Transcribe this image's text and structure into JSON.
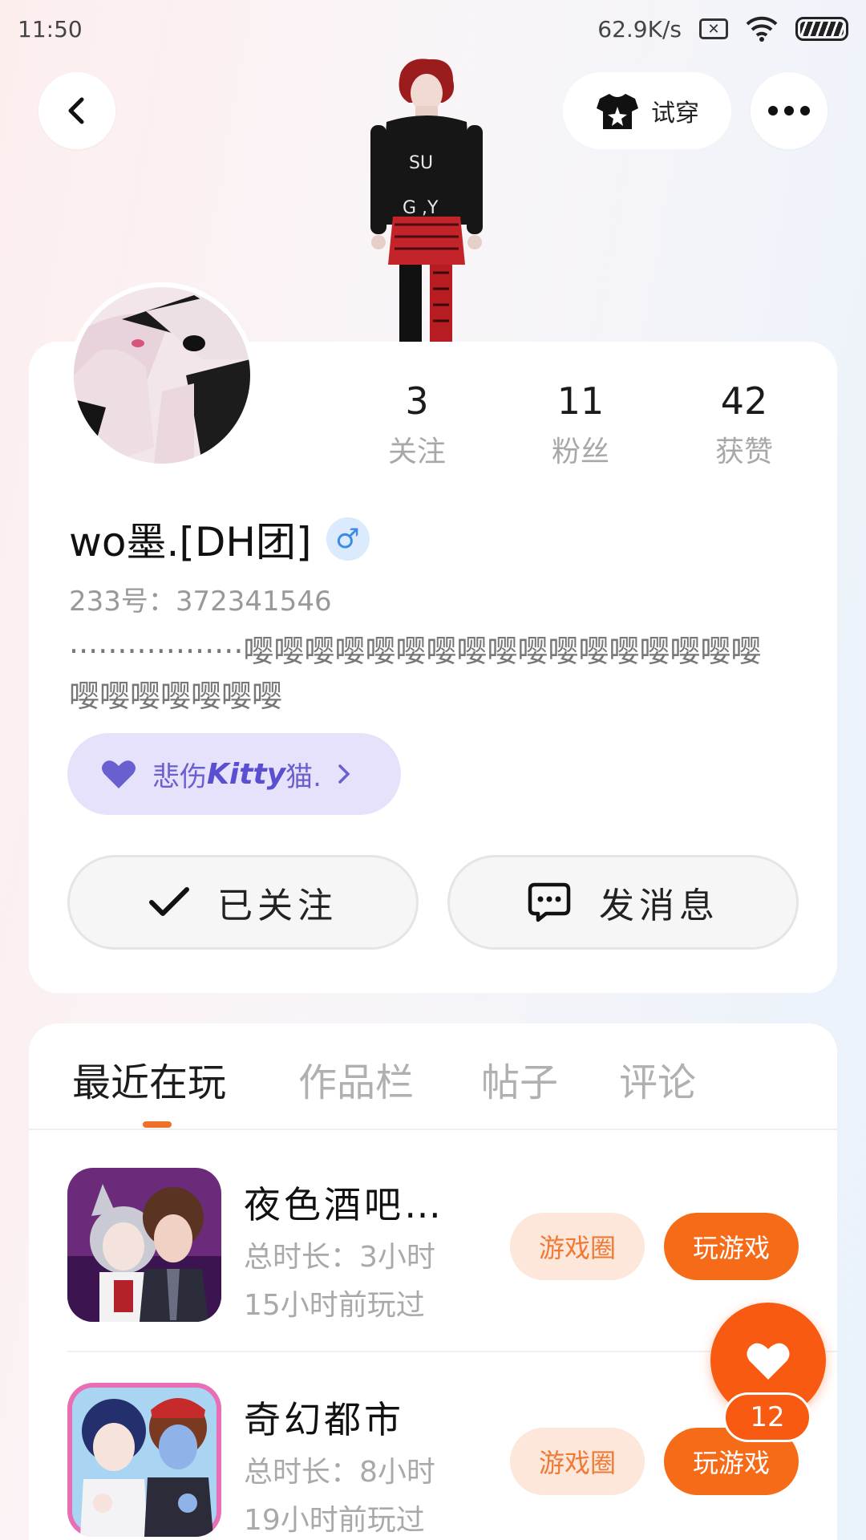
{
  "status_bar": {
    "time": "11:50",
    "net_speed": "62.9K/s"
  },
  "header": {
    "try_on_label": "试穿"
  },
  "profile": {
    "stats": [
      {
        "value": "3",
        "label": "关注"
      },
      {
        "value": "11",
        "label": "粉丝"
      },
      {
        "value": "42",
        "label": "获赞"
      }
    ],
    "username": "wo墨.[DH团]",
    "gender_symbol": "♂",
    "user_id": "233号：372341546",
    "bio": "··················嘤嘤嘤嘤嘤嘤嘤嘤嘤嘤嘤嘤嘤嘤嘤嘤嘤嘤嘤嘤嘤嘤嘤嘤",
    "guild": {
      "prefix": "悲伤",
      "name": "Kitty",
      "suffix": "猫."
    },
    "followed_label": "已关注",
    "message_label": "发消息"
  },
  "tabs": [
    "最近在玩",
    "作品栏",
    "帖子",
    "评论"
  ],
  "games": [
    {
      "name": "夜色酒吧…",
      "total_time": "总时长：3小时",
      "last_played": "15小时前玩过",
      "circle_label": "游戏圈",
      "play_label": "玩游戏"
    },
    {
      "name": "奇幻都市",
      "total_time": "总时长：8小时",
      "last_played": "19小时前玩过",
      "circle_label": "游戏圈",
      "play_label": "玩游戏"
    }
  ],
  "floating_like": {
    "count": "12"
  },
  "colors": {
    "accent": "#f56b18",
    "guild_bg": "#e7e2fb",
    "guild_text": "#6a5fcf",
    "gender": "#3b8be8"
  },
  "icons": [
    "back-icon",
    "shirt-star-icon",
    "more-icon",
    "check-icon",
    "chat-bubble-icon",
    "heart-icon",
    "chevron-right-icon",
    "wifi-icon",
    "battery-icon"
  ]
}
